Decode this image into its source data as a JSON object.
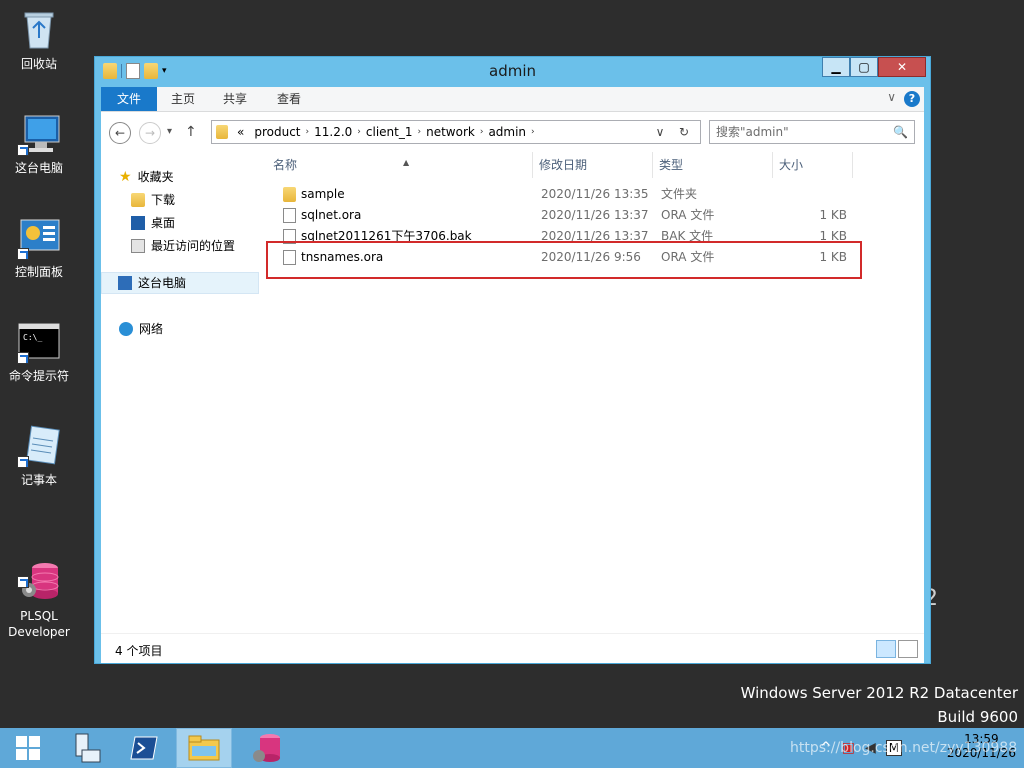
{
  "desktop": {
    "icons": [
      {
        "label": "回收站"
      },
      {
        "label": "这台电脑"
      },
      {
        "label": "控制面板"
      },
      {
        "label": "命令提示符"
      },
      {
        "label": "记事本"
      },
      {
        "label": "PLSQL\nDeveloper"
      }
    ],
    "brand_line1": "Windows Server 2012 R2 Datacenter",
    "brand_line2": "Build 9600",
    "r2_fragment": "2"
  },
  "window": {
    "title": "admin",
    "controls": {
      "minimize": "▁",
      "maximize": "▢",
      "close": "✕"
    },
    "ribbon": {
      "tabs": [
        "文件",
        "主页",
        "共享",
        "查看"
      ],
      "collapse_glyph": "∨",
      "help": "?"
    },
    "nav": {
      "back": "←",
      "forward": "→",
      "history": "▾",
      "up": "↑",
      "address_prefix": "«",
      "path": [
        "product",
        "11.2.0",
        "client_1",
        "network",
        "admin"
      ],
      "path_sep": "›",
      "dropdown": "∨",
      "refresh": "↻",
      "search_placeholder": "搜索\"admin\"",
      "search_icon": "🔍"
    },
    "navpane": {
      "favorites": "收藏夹",
      "downloads": "下载",
      "desktop": "桌面",
      "recent": "最近访问的位置",
      "this_pc": "这台电脑",
      "network": "网络"
    },
    "columns": [
      "名称",
      "修改日期",
      "类型",
      "大小"
    ],
    "sort_indicator": "▲",
    "files": [
      {
        "name": "sample",
        "date": "2020/11/26 13:35",
        "type": "文件夹",
        "size": "",
        "kind": "folder"
      },
      {
        "name": "sqlnet.ora",
        "date": "2020/11/26 13:37",
        "type": "ORA 文件",
        "size": "1 KB",
        "kind": "doc"
      },
      {
        "name": "sqlnet2011261下午3706.bak",
        "date": "2020/11/26 13:37",
        "type": "BAK 文件",
        "size": "1 KB",
        "kind": "doc"
      },
      {
        "name": "tnsnames.ora",
        "date": "2020/11/26 9:56",
        "type": "ORA 文件",
        "size": "1 KB",
        "kind": "doc"
      }
    ],
    "status": "4 个项目"
  },
  "taskbar": {
    "time": "13:59",
    "date": "2020/11/26",
    "tray_m": "M",
    "watermark": "https://blog.csdn.net/zyy130988"
  },
  "colors": {
    "window_frame": "#6bc0ea",
    "ribbon_file_tab": "#1979ca",
    "highlight_box": "#d22a2a",
    "taskbar": "#5fa8d8"
  }
}
